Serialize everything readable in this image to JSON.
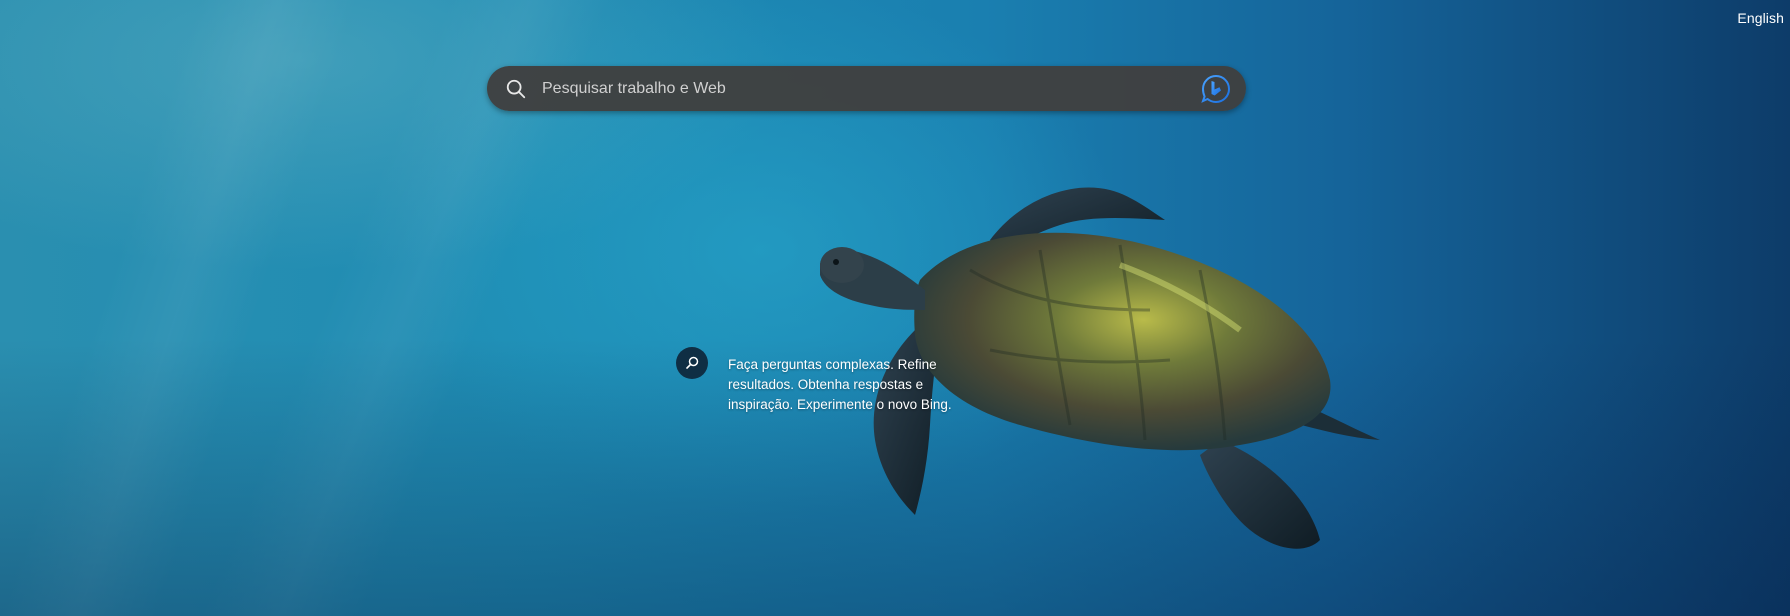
{
  "header": {
    "language_link": "English"
  },
  "search": {
    "placeholder": "Pesquisar trabalho e Web",
    "value": "",
    "search_icon": "search-icon",
    "chat_icon": "bing-chat-icon"
  },
  "promo": {
    "icon": "search-icon",
    "text": "Faça perguntas complexas. Refine resultados. Obtenha respostas e inspiração. Experimente o novo Bing."
  },
  "background": {
    "subject": "sea turtle underwater",
    "accent": "#1e8cb4"
  }
}
